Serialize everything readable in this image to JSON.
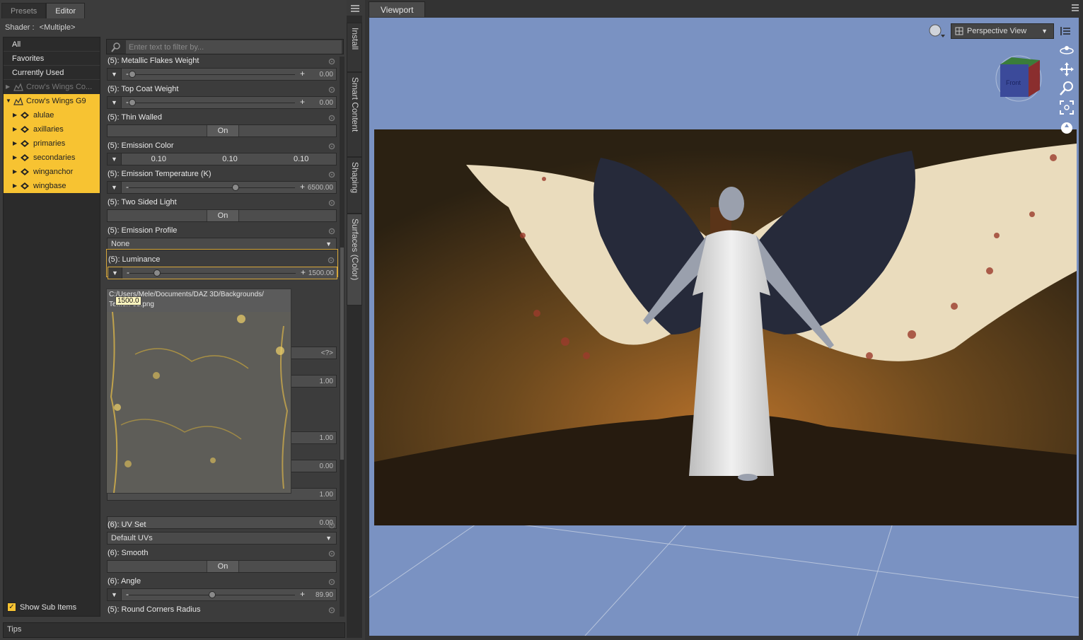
{
  "panel": {
    "tabs": [
      "Presets",
      "Editor"
    ],
    "active_tab": "Editor",
    "shader_label": "Shader :",
    "shader_value": "<Multiple>",
    "filter_placeholder": "Enter text to filter by...",
    "show_sub_items": "Show Sub Items",
    "tips": "Tips"
  },
  "categories": [
    "All",
    "Favorites",
    "Currently Used"
  ],
  "tree": {
    "dim_item": "Crow's Wings Co...",
    "root": "Crow's Wings G9",
    "children": [
      "alulae",
      "axillaries",
      "primaries",
      "secondaries",
      "winganchor",
      "wingbase"
    ]
  },
  "properties": [
    {
      "label": "(5): Metallic Flakes Weight",
      "type": "slider",
      "value": "0.00",
      "fraction": 0.0
    },
    {
      "label": "(5): Top Coat Weight",
      "type": "slider",
      "value": "0.00",
      "fraction": 0.0
    },
    {
      "label": "(5): Thin Walled",
      "type": "toggle",
      "value": "On"
    },
    {
      "label": "(5): Emission Color",
      "type": "color",
      "values": [
        "0.10",
        "0.10",
        "0.10"
      ]
    },
    {
      "label": "(5): Emission Temperature (K)",
      "type": "slider",
      "value": "6500.00",
      "fraction": 0.65
    },
    {
      "label": "(5): Two Sided Light",
      "type": "toggle",
      "value": "On"
    },
    {
      "label": "(5): Emission Profile",
      "type": "combo",
      "value": "None"
    },
    {
      "label": "(5): Luminance",
      "type": "slider",
      "value": "1500.00",
      "fraction": 0.15
    }
  ],
  "lower_properties": [
    {
      "label": "(6): UV Set",
      "type": "combo",
      "value": "Default UVs"
    },
    {
      "label": "(6): Smooth",
      "type": "toggle",
      "value": "On"
    },
    {
      "label": "(6): Angle",
      "type": "slider",
      "value": "89.90",
      "fraction": 0.5
    },
    {
      "label": "(5): Round Corners Radius",
      "type": "slider",
      "value": "",
      "fraction": 0.5
    }
  ],
  "hidden_values": {
    "v1": "<?>",
    "v2": "1.00",
    "v3": "1.00",
    "v4": "0.00",
    "v5": "1.00",
    "v6": "0.00"
  },
  "popup": {
    "path_line1": "C:/Users/Mele/Documents/DAZ 3D/Backgrounds/",
    "path_line2": "Te...en-03.png",
    "tooltip": "1500.0"
  },
  "side_tabs": [
    "Install",
    "Smart Content",
    "Shaping",
    "Surfaces (Color)"
  ],
  "viewport": {
    "tab": "Viewport",
    "view_mode": "Perspective View",
    "cube_face": "Front"
  },
  "colors": {
    "highlight": "#f7c332",
    "viewport_bg": "#7a92c2"
  }
}
